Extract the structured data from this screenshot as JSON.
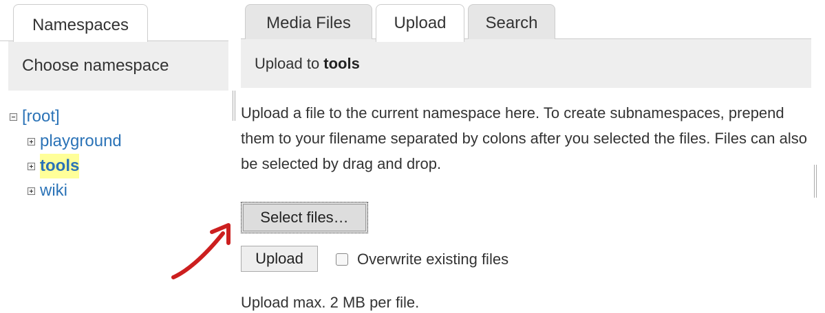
{
  "left_panel": {
    "tab_label": "Namespaces",
    "header": "Choose namespace",
    "tree": {
      "root": "[root]",
      "children": [
        "playground",
        "tools",
        "wiki"
      ],
      "current": "tools"
    }
  },
  "right_panel": {
    "tabs": [
      {
        "label": "Media Files",
        "active": false
      },
      {
        "label": "Upload",
        "active": true
      },
      {
        "label": "Search",
        "active": false
      }
    ],
    "header_prefix": "Upload to ",
    "header_namespace": "tools",
    "intro_text": "Upload a file to the current namespace here. To create subnamespaces, prepend them to your filename separated by colons after you selected the files. Files can also be selected by drag and drop.",
    "select_files_label": "Select files…",
    "upload_label": "Upload",
    "overwrite_label": "Overwrite existing files",
    "overwrite_checked": false,
    "max_note": "Upload max. 2 MB per file."
  },
  "colors": {
    "link": "#2b73b7",
    "highlight": "#ffff99",
    "header_bg": "#eeeeee",
    "annotation_arrow": "#cc1f1f"
  },
  "icons": {
    "tree_collapse": "minus-box-icon",
    "tree_expand": "plus-box-icon",
    "annotation": "red-arrow-icon"
  }
}
